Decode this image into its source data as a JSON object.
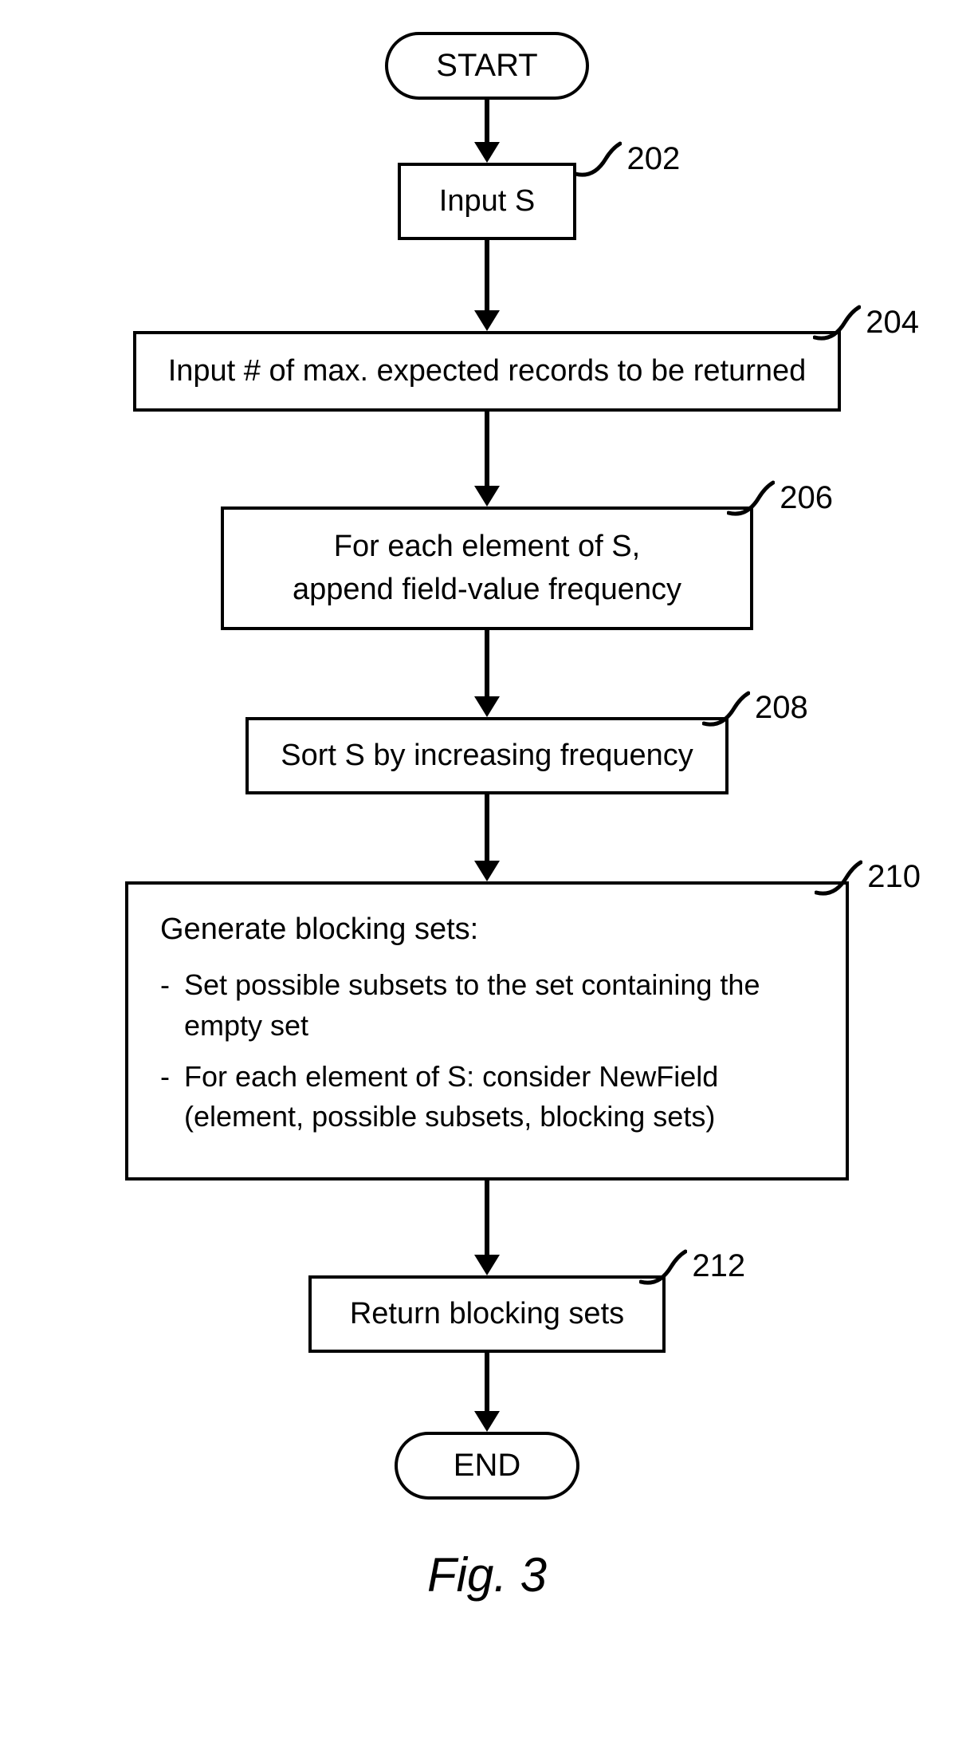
{
  "chart_data": {
    "type": "flowchart",
    "title": "Fig. 3",
    "nodes": [
      {
        "id": "start",
        "shape": "terminal",
        "label": "START"
      },
      {
        "id": "n202",
        "shape": "process",
        "ref": "202",
        "label": "Input S"
      },
      {
        "id": "n204",
        "shape": "process",
        "ref": "204",
        "label": "Input # of max. expected records to be returned"
      },
      {
        "id": "n206",
        "shape": "process",
        "ref": "206",
        "label_lines": [
          "For each element of S,",
          "append field-value frequency"
        ]
      },
      {
        "id": "n208",
        "shape": "process",
        "ref": "208",
        "label": "Sort S by increasing frequency"
      },
      {
        "id": "n210",
        "shape": "process",
        "ref": "210",
        "heading": "Generate blocking sets:",
        "items": [
          "Set possible subsets to the set containing the empty set",
          "For each element of S: consider NewField (element, possible subsets, blocking sets)"
        ]
      },
      {
        "id": "n212",
        "shape": "process",
        "ref": "212",
        "label": "Return blocking sets"
      },
      {
        "id": "end",
        "shape": "terminal",
        "label": "END"
      }
    ],
    "edges": [
      [
        "start",
        "n202"
      ],
      [
        "n202",
        "n204"
      ],
      [
        "n204",
        "n206"
      ],
      [
        "n206",
        "n208"
      ],
      [
        "n208",
        "n210"
      ],
      [
        "n210",
        "n212"
      ],
      [
        "n212",
        "end"
      ]
    ]
  }
}
